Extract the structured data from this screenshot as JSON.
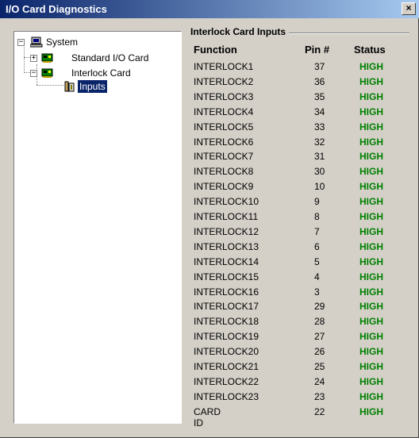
{
  "window": {
    "title": "I/O Card Diagnostics",
    "close_glyph": "×"
  },
  "tree": {
    "system": "System",
    "standard_io": "Standard I/O Card",
    "interlock_card": "Interlock Card",
    "inputs": "Inputs"
  },
  "panel": {
    "title": "Interlock Card Inputs",
    "headers": {
      "function": "Function",
      "pin": "Pin #",
      "status": "Status"
    },
    "rows": [
      {
        "function": "INTERLOCK1",
        "pin": "37",
        "status": "HIGH"
      },
      {
        "function": "INTERLOCK2",
        "pin": "36",
        "status": "HIGH"
      },
      {
        "function": "INTERLOCK3",
        "pin": "35",
        "status": "HIGH"
      },
      {
        "function": "INTERLOCK4",
        "pin": "34",
        "status": "HIGH"
      },
      {
        "function": "INTERLOCK5",
        "pin": "33",
        "status": "HIGH"
      },
      {
        "function": "INTERLOCK6",
        "pin": "32",
        "status": "HIGH"
      },
      {
        "function": "INTERLOCK7",
        "pin": "31",
        "status": "HIGH"
      },
      {
        "function": "INTERLOCK8",
        "pin": "30",
        "status": "HIGH"
      },
      {
        "function": "INTERLOCK9",
        "pin": "10",
        "status": "HIGH"
      },
      {
        "function": "INTERLOCK10",
        "pin": "9",
        "status": "HIGH"
      },
      {
        "function": "INTERLOCK11",
        "pin": "8",
        "status": "HIGH"
      },
      {
        "function": "INTERLOCK12",
        "pin": "7",
        "status": "HIGH"
      },
      {
        "function": "INTERLOCK13",
        "pin": "6",
        "status": "HIGH"
      },
      {
        "function": "INTERLOCK14",
        "pin": "5",
        "status": "HIGH"
      },
      {
        "function": "INTERLOCK15",
        "pin": "4",
        "status": "HIGH"
      },
      {
        "function": "INTERLOCK16",
        "pin": "3",
        "status": "HIGH"
      },
      {
        "function": "INTERLOCK17",
        "pin": "29",
        "status": "HIGH"
      },
      {
        "function": "INTERLOCK18",
        "pin": "28",
        "status": "HIGH"
      },
      {
        "function": "INTERLOCK19",
        "pin": "27",
        "status": "HIGH"
      },
      {
        "function": "INTERLOCK20",
        "pin": "26",
        "status": "HIGH"
      },
      {
        "function": "INTERLOCK21",
        "pin": "25",
        "status": "HIGH"
      },
      {
        "function": "INTERLOCK22",
        "pin": "24",
        "status": "HIGH"
      },
      {
        "function": "INTERLOCK23",
        "pin": "23",
        "status": "HIGH"
      },
      {
        "function": "CARD ID",
        "pin": "22",
        "status": "HIGH"
      }
    ]
  },
  "colors": {
    "title_start": "#0a246a",
    "title_end": "#a6caf0",
    "status_high": "#008000",
    "face": "#d4d0c8"
  }
}
